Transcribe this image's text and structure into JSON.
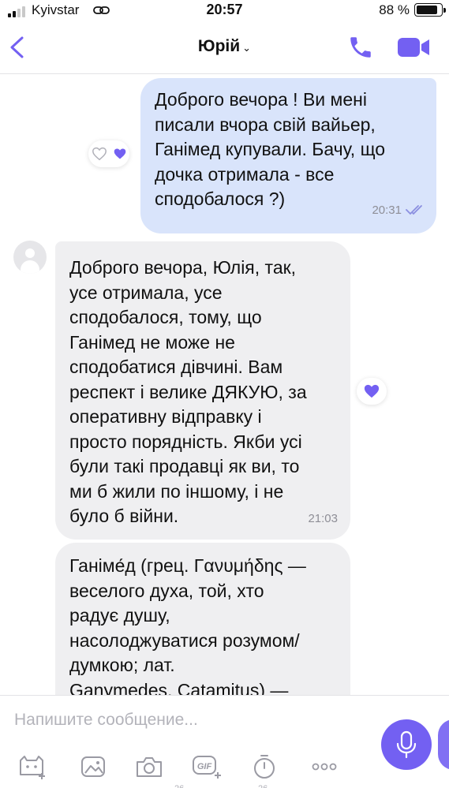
{
  "status_bar": {
    "carrier": "Kyivstar",
    "time": "20:57",
    "battery_percent": "88 %",
    "battery_level": 0.88
  },
  "header": {
    "contact_name": "Юрій",
    "chevron": "⌄"
  },
  "messages": [
    {
      "direction": "outgoing",
      "text": "Доброго вечора ! Ви мені\nписали вчора свій вайьер,\nГанімед купували. Бачу, що\nдочка отримала - все\nсподобалося ?)",
      "time": "20:31",
      "status": "read",
      "reactions": [
        "heart-outline-icon",
        "heart-filled-icon"
      ]
    },
    {
      "direction": "incoming",
      "text": "Доброго вечора, Юлія, так,\nусе отримала, усе\nсподобалося, тому, що\nГанімед не може не\nсподобатися дівчині. Вам\nреспект і велике ДЯКУЮ, за\nоперативну відправку і\nпросто порядність. Якби усі\nбули такі продавці як ви, то\nми б жили по іншому, і не\nбуло б війни.",
      "time": "21:03",
      "reactions": [
        "heart-filled-icon"
      ]
    },
    {
      "direction": "incoming",
      "text": "Ганіме́д (грец. Γανυμήδης —\nвеселого духа, той, хто\nрадує душу,\nнасолоджуватися розумом/\nдумкою; лат.\nGanymedes, Catamitus) —"
    }
  ],
  "composer": {
    "placeholder": "Напишите сообщение...",
    "value": "",
    "tools": [
      "sticker-icon",
      "gallery-icon",
      "camera-icon",
      "gif-icon",
      "timer-icon",
      "more-icon"
    ],
    "tool_counts": [
      "26",
      "26"
    ]
  },
  "colors": {
    "accent": "#7360f2",
    "outgoing_bubble": "#d9e4fb",
    "incoming_bubble": "#efeff1",
    "read_check": "#8b8fe0"
  }
}
